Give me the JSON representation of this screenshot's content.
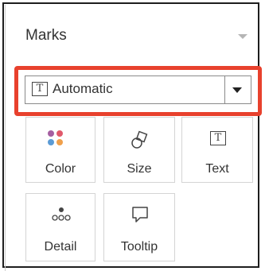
{
  "panel": {
    "title": "Marks"
  },
  "mark_type": {
    "selected": "Automatic"
  },
  "cards": [
    {
      "label": "Color",
      "icon": "color-dots-icon"
    },
    {
      "label": "Size",
      "icon": "size-shapes-icon"
    },
    {
      "label": "Text",
      "icon": "text-box-icon"
    },
    {
      "label": "Detail",
      "icon": "detail-dots-icon"
    },
    {
      "label": "Tooltip",
      "icon": "speech-bubble-icon"
    }
  ],
  "colors": {
    "highlight": "#e8412d",
    "color_dot_1": "#a55fa1",
    "color_dot_2": "#e0596b",
    "color_dot_3": "#5b9bd5",
    "color_dot_4": "#f0a04b"
  }
}
